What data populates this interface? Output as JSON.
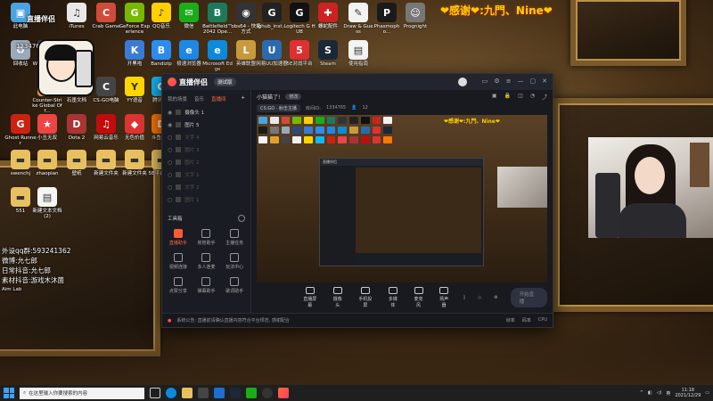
{
  "overlay": {
    "thanks_text": "❤感谢❤:九門、Nine❤",
    "watermark_top": "直播伴侣",
    "watermark_id": "1334765",
    "info_lines": [
      "外设qq群:593241362",
      "微博:允七郎",
      "日常抖音:允七郎",
      "素材抖音:游戏木沐菌",
      "Aim Lab"
    ]
  },
  "desktop_icons": [
    {
      "label": "此电脑",
      "color": "#4aa3df",
      "glyph": "▣"
    },
    {
      "label": "iTunes",
      "color": "#e8e8e8",
      "glyph": "♫"
    },
    {
      "label": "Crab Game",
      "color": "#d14a3a",
      "glyph": "C"
    },
    {
      "label": "GeForce Experience",
      "color": "#76b900",
      "glyph": "G"
    },
    {
      "label": "QQ音乐",
      "color": "#ffcf00",
      "glyph": "♪"
    },
    {
      "label": "微信",
      "color": "#1aad19",
      "glyph": "✉"
    },
    {
      "label": "Battlefield™ 2042 Ope...",
      "color": "#1c7a5a",
      "glyph": "B"
    },
    {
      "label": "obs64 - 快捷方式",
      "color": "#333",
      "glyph": "◉"
    },
    {
      "label": "lghub_inst...",
      "color": "#222",
      "glyph": "G"
    },
    {
      "label": "Logitech G HUB",
      "color": "#111",
      "glyph": "G"
    },
    {
      "label": "螺蛇配件",
      "color": "#c22",
      "glyph": "✚"
    },
    {
      "label": "Draw & Guess",
      "color": "#f2f2f2",
      "glyph": "✎"
    },
    {
      "label": "Phasmopho...",
      "color": "#1a1a1a",
      "glyph": "P"
    },
    {
      "label": "Prognight",
      "color": "#777",
      "glyph": "☺"
    },
    {
      "label": "回收站",
      "color": "#9ab",
      "glyph": "♻"
    },
    {
      "label": "Wallpaper Engine",
      "color": "#2a4a7a",
      "glyph": "W"
    },
    {
      "label": "开黑啦",
      "color": "#3a7bd5",
      "glyph": "K"
    },
    {
      "label": "Bandizip",
      "color": "#2d8cf0",
      "glyph": "B"
    },
    {
      "label": "极速浏览器",
      "color": "#1e88e5",
      "glyph": "e"
    },
    {
      "label": "Microsoft Edge",
      "color": "#0c8adb",
      "glyph": "e"
    },
    {
      "label": "英雄联盟",
      "color": "#c89b3c",
      "glyph": "L"
    },
    {
      "label": "网易UU加速器",
      "color": "#2b6cb0",
      "glyph": "U"
    },
    {
      "label": "5E对战平台",
      "color": "#e03030",
      "glyph": "5"
    },
    {
      "label": "Steam",
      "color": "#1b2838",
      "glyph": "S"
    },
    {
      "label": "使用指南",
      "color": "#f5f5f5",
      "glyph": "▤"
    },
    {
      "label": "Counter-Strike Global Off...",
      "color": "#e0a030",
      "glyph": "C"
    },
    {
      "label": "CS-GO电脑",
      "color": "#444",
      "glyph": "C"
    },
    {
      "label": "石墨文档",
      "color": "#f0f0f0",
      "glyph": "▤"
    },
    {
      "label": "YY语音",
      "color": "#ffd600",
      "glyph": "Y"
    },
    {
      "label": "腾讯QQ",
      "color": "#12b7f5",
      "glyph": "Q"
    },
    {
      "label": "Ghost Runner",
      "color": "#c21",
      "glyph": "G"
    },
    {
      "label": "小丑无双",
      "color": "#e44",
      "glyph": "★"
    },
    {
      "label": "Dota 2",
      "color": "#a33",
      "glyph": "D"
    },
    {
      "label": "网易云音乐",
      "color": "#c20c0c",
      "glyph": "♫"
    },
    {
      "label": "无色价值",
      "color": "#d33",
      "glyph": "◆"
    },
    {
      "label": "斗鱼直播",
      "color": "#f70",
      "glyph": "D"
    },
    {
      "label": "swenchj",
      "color": "#e8c060",
      "glyph": "▬"
    },
    {
      "label": "zhaopian",
      "color": "#e8c060",
      "glyph": "▬"
    },
    {
      "label": "壁纸",
      "color": "#e8c060",
      "glyph": "▬"
    },
    {
      "label": "新建文件夹",
      "color": "#e8c060",
      "glyph": "▬"
    },
    {
      "label": "新建文件夹",
      "color": "#e8c060",
      "glyph": "▬"
    },
    {
      "label": "5E平台录像",
      "color": "#e8c060",
      "glyph": "▬"
    },
    {
      "label": "551",
      "color": "#e8c060",
      "glyph": "▬"
    },
    {
      "label": "新建文本文档(2)",
      "color": "#f5f5f5",
      "glyph": "▤"
    }
  ],
  "app": {
    "title": "直播伴侣",
    "beta_label": "测试版",
    "left_tabs": [
      "我的场景",
      "音乐",
      "直播间"
    ],
    "active_tab_index": 2,
    "scenes": [
      {
        "label": "摄像头 1",
        "visible": true
      },
      {
        "label": "图片 5",
        "visible": true
      },
      {
        "label": "文字 4",
        "visible": false
      },
      {
        "label": "图片 3",
        "visible": false
      },
      {
        "label": "图片 2",
        "visible": false
      },
      {
        "label": "文字 1",
        "visible": false
      },
      {
        "label": "文字 2",
        "visible": false
      },
      {
        "label": "图片 1",
        "visible": false
      }
    ],
    "tools_title": "工具箱",
    "tools": [
      {
        "label": "直播助手",
        "hot": true
      },
      {
        "label": "房管助手",
        "hot": false
      },
      {
        "label": "主播任务",
        "hot": false
      },
      {
        "label": "视频连接",
        "hot": false
      },
      {
        "label": "多人连麦",
        "hot": false
      },
      {
        "label": "玩法中心",
        "hot": false
      },
      {
        "label": "点赞分享",
        "hot": false
      },
      {
        "label": "弹幕助手",
        "hot": false
      },
      {
        "label": "歌词助手",
        "hot": false
      }
    ],
    "stream_title": "小猫猫了!",
    "edit_label": "修改",
    "category": "CS:GO · 射击主播",
    "room_id_label": "房间ID:",
    "room_id": "1334765",
    "viewers": "12",
    "bottom_actions": [
      "直播屏幕",
      "摄像头",
      "手机投屏",
      "多媒体",
      "麦克风",
      "扬声器"
    ],
    "start_button": "开始直播",
    "status_notice": "系统公告: 直播前请确认直播内容符合平台规范, 感谢配合",
    "status_right": [
      "帧率",
      "码率",
      "CPU"
    ]
  },
  "taskbar": {
    "search_placeholder": "在这里输入你要搜索的内容",
    "time": "11:18",
    "date": "2021/12/29",
    "lang": "英"
  }
}
